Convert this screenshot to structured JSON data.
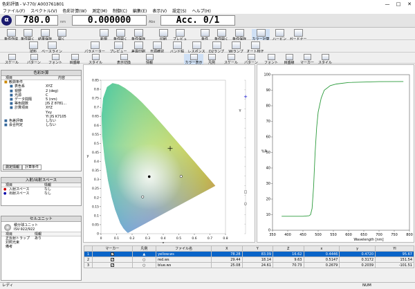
{
  "window": {
    "title": "色彩評価 - V-770/ A003761801",
    "minimize": "—",
    "maximize": "□",
    "close": "✕"
  },
  "menu": [
    "ファイル(F)",
    "スペクトル(V)",
    "色彩計算(W)",
    "測定(M)",
    "制御(C)",
    "編集(E)",
    "表示(V)",
    "設定(S)",
    "ヘルプ(H)"
  ],
  "measure": {
    "wavelength": "780.0",
    "wl_unit": "nm",
    "abs": "0.000000",
    "abs_unit": "Abs",
    "acc": "Acc. 0/1"
  },
  "toolbar1": [
    "条件作成",
    "条件開く",
    "結果保存",
    "開く",
    "新規",
    "条件開く",
    "条件保存",
    "印刷",
    "プレビュー",
    "条件",
    "条件開く",
    "条件保存",
    "カラー計算",
    "ハービン",
    "ガードナー"
  ],
  "toolbar2": [
    "試料",
    "ベースライン",
    "パラメーター",
    "プレビュー",
    "差異印刷",
    "光源確認",
    "バンド幅",
    "レスポンス",
    "D2ランプ",
    "WIランプ",
    "オート校正"
  ],
  "toolbar3a": [
    "スケール",
    "パターン",
    "フォント",
    "目盛線",
    "スタイル",
    "表示切換",
    "情報",
    "カラー表示"
  ],
  "toolbar3b": [
    "凡例",
    "スケール",
    "パターン",
    "フォント",
    "目盛線",
    "マーカー",
    "スタイル"
  ],
  "calc_panel": {
    "title": "色彩計算",
    "col_item": "項目",
    "col_value": "内容",
    "rows": [
      {
        "label": "観測条件",
        "value": ""
      },
      {
        "label": "表色系",
        "value": "XYZ"
      },
      {
        "label": "視野",
        "value": "2 (deg)"
      },
      {
        "label": "光源",
        "value": "C"
      },
      {
        "label": "データ間隔",
        "value": "5 (nm)"
      },
      {
        "label": "等色関数",
        "value": "JIS Z 8781..."
      },
      {
        "label": "計算項目",
        "value": "XYZ"
      },
      {
        "label": "",
        "value": "Yxy"
      },
      {
        "label": "",
        "value": "YI JIS K7105"
      },
      {
        "label": "色差評価",
        "value": "しない"
      },
      {
        "label": "会合判定",
        "value": "しない"
      }
    ],
    "tabs": [
      "測定情報",
      "計算条件"
    ]
  },
  "io_panel": {
    "title": "入射/出射スペース",
    "col_item": "項目",
    "col_value": "情報",
    "rows": [
      {
        "label": "入射スペース",
        "value": "なし"
      },
      {
        "label": "出射スペース",
        "value": "なし"
      }
    ]
  },
  "cell_panel": {
    "title": "セルユニット",
    "unit": "積分球ユニット",
    "model": "ISV-922/922",
    "col_item": "項目",
    "col_value": "情報",
    "rows": [
      {
        "label": "正反射トラップ",
        "value": "あり"
      },
      {
        "label": "対照光束",
        "value": ""
      },
      {
        "label": "備考",
        "value": ""
      }
    ]
  },
  "chart_data": [
    {
      "type": "scatter",
      "title": "",
      "xlabel": "x",
      "ylabel": "y",
      "xlim": [
        0,
        0.8
      ],
      "ylim": [
        0,
        0.85
      ],
      "xticks": [
        "0",
        "0.1",
        "0.2",
        "0.3",
        "0.4",
        "0.5",
        "0.6",
        "0.7",
        "0.8"
      ],
      "yticks": [
        "0",
        "0.05",
        "0.1",
        "0.15",
        "0.2",
        "0.25",
        "0.3",
        "0.35",
        "0.4",
        "0.45",
        "0.5",
        "0.55",
        "0.6",
        "0.65",
        "0.7",
        "0.75",
        "0.8",
        "0.85"
      ],
      "series": [
        {
          "name": "yellow.ws",
          "x": [
            0.4446
          ],
          "y": [
            0.472
          ],
          "marker": "plus"
        },
        {
          "name": "red.ws",
          "x": [
            0.5147
          ],
          "y": [
            0.3172
          ],
          "marker": "circle-open"
        },
        {
          "name": "blue.ws",
          "x": [
            0.2679
          ],
          "y": [
            0.2039
          ],
          "marker": "circle-open"
        },
        {
          "name": "white point",
          "x": [
            0.31
          ],
          "y": [
            0.316
          ],
          "marker": "dot"
        }
      ]
    },
    {
      "type": "scatter",
      "title": "",
      "xlabel": "",
      "ylabel": "Y",
      "side_markers": [
        "+",
        "□",
        "○"
      ]
    },
    {
      "type": "line",
      "title": "",
      "xlabel": "Wavelength [nm]",
      "ylabel": "%R",
      "xlim": [
        350,
        800
      ],
      "ylim": [
        0,
        100
      ],
      "xticks": [
        "350",
        "400",
        "450",
        "500",
        "550",
        "600",
        "650",
        "700",
        "750",
        "800"
      ],
      "yticks": [
        "0",
        "10",
        "20",
        "30",
        "40",
        "50",
        "60",
        "70",
        "80",
        "90",
        "100"
      ],
      "series": [
        {
          "name": "yellow.ws",
          "x": [
            380,
            400,
            450,
            470,
            475,
            480,
            485,
            490,
            495,
            500,
            510,
            520,
            540,
            560,
            600,
            700,
            780
          ],
          "y": [
            9,
            9,
            9,
            9.3,
            10,
            14,
            28,
            50,
            66,
            76,
            85,
            90,
            93,
            94,
            95,
            95.5,
            95.6
          ]
        }
      ]
    }
  ],
  "results": {
    "headers": [
      "",
      "マーカー",
      "凡例",
      "ファイル名",
      "X",
      "Y",
      "Z",
      "x",
      "y",
      "YI"
    ],
    "rows": [
      {
        "no": "1",
        "legend": "▲",
        "file": "yellow.ws",
        "X": "78.28",
        "Y": "83.09",
        "Z": "16.62",
        "x": "0.4446",
        "y": "0.4720",
        "YI": "95.67"
      },
      {
        "no": "2",
        "legend": "○",
        "file": "red.ws",
        "X": "29.44",
        "Y": "18.14",
        "Z": "9.63",
        "x": "0.5147",
        "y": "0.3172",
        "YI": "151.54"
      },
      {
        "no": "3",
        "legend": "○",
        "file": "blue.ws",
        "X": "25.08",
        "Y": "24.61",
        "Z": "70.73",
        "x": "0.2679",
        "y": "0.2039",
        "YI": "-101.51"
      }
    ]
  },
  "status": {
    "left": "レディ",
    "right": "NUM"
  }
}
